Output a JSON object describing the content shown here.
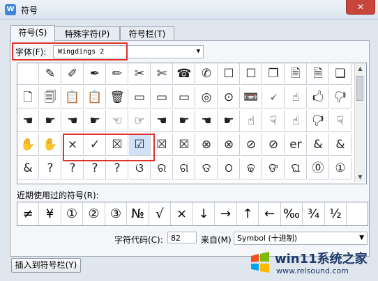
{
  "window": {
    "title": "符号",
    "app_icon_letter": "W",
    "close_glyph": "✕"
  },
  "tabs": [
    {
      "label": "符号(S)",
      "active": true
    },
    {
      "label": "特殊字符(P)",
      "active": false
    },
    {
      "label": "符号栏(T)",
      "active": false
    }
  ],
  "font": {
    "label": "字体(F):",
    "value": "Wingdings 2",
    "arrow": "▼"
  },
  "symbol_grid": {
    "rows": [
      [
        "",
        "✎",
        "✐",
        "✒",
        "✏",
        "✂",
        "✄",
        "☎",
        "✆",
        "☐",
        "☐",
        "❐",
        "🖹",
        "🗎",
        "❏"
      ],
      [
        "🗋",
        "🗐",
        "📋",
        "📋",
        "🗑",
        "▭",
        "▭",
        "▭",
        "◎",
        "⊙",
        "📼",
        "🗸",
        "☝",
        "🖒",
        "🖓"
      ],
      [
        "☚",
        "☛",
        "☚",
        "☛",
        "☜",
        "☞",
        "☚",
        "☛",
        "☚",
        "☛",
        "☝",
        "☟",
        "☝",
        "🖓",
        "☟"
      ],
      [
        "✋",
        "✋",
        "×",
        "✓",
        "☒",
        "☑",
        "☒",
        "☒",
        "⊗",
        "⊗",
        "⊘",
        "⊘",
        "er",
        "&",
        "&"
      ],
      [
        "&",
        "?",
        "?",
        "?",
        "?",
        "ଓ",
        "ର",
        "ଗ",
        "ଡ",
        "ଠ",
        "ଢ",
        "ଙ",
        "ଘ",
        "⓪",
        "①"
      ]
    ],
    "selected_cell": {
      "row": 3,
      "col": 5
    }
  },
  "recent": {
    "label": "近期使用过的符号(R):",
    "symbols": [
      "≠",
      "¥",
      "①",
      "②",
      "③",
      "№",
      "√",
      "×",
      "↓",
      "→",
      "↑",
      "←",
      "‰",
      "¾",
      "½"
    ]
  },
  "char_code": {
    "label": "字符代码(C):",
    "value": "82"
  },
  "from": {
    "label": "来自(M)",
    "value": "Symbol (十进制)",
    "arrow": "▼"
  },
  "buttons": {
    "insert_to_bar": "插入到符号栏(Y)"
  },
  "watermark": {
    "site_name": "win11系统之家",
    "url": "www.relsound.com"
  },
  "colors": {
    "highlight_red": "#e0312a",
    "selection_blue": "#cfe2f7"
  }
}
